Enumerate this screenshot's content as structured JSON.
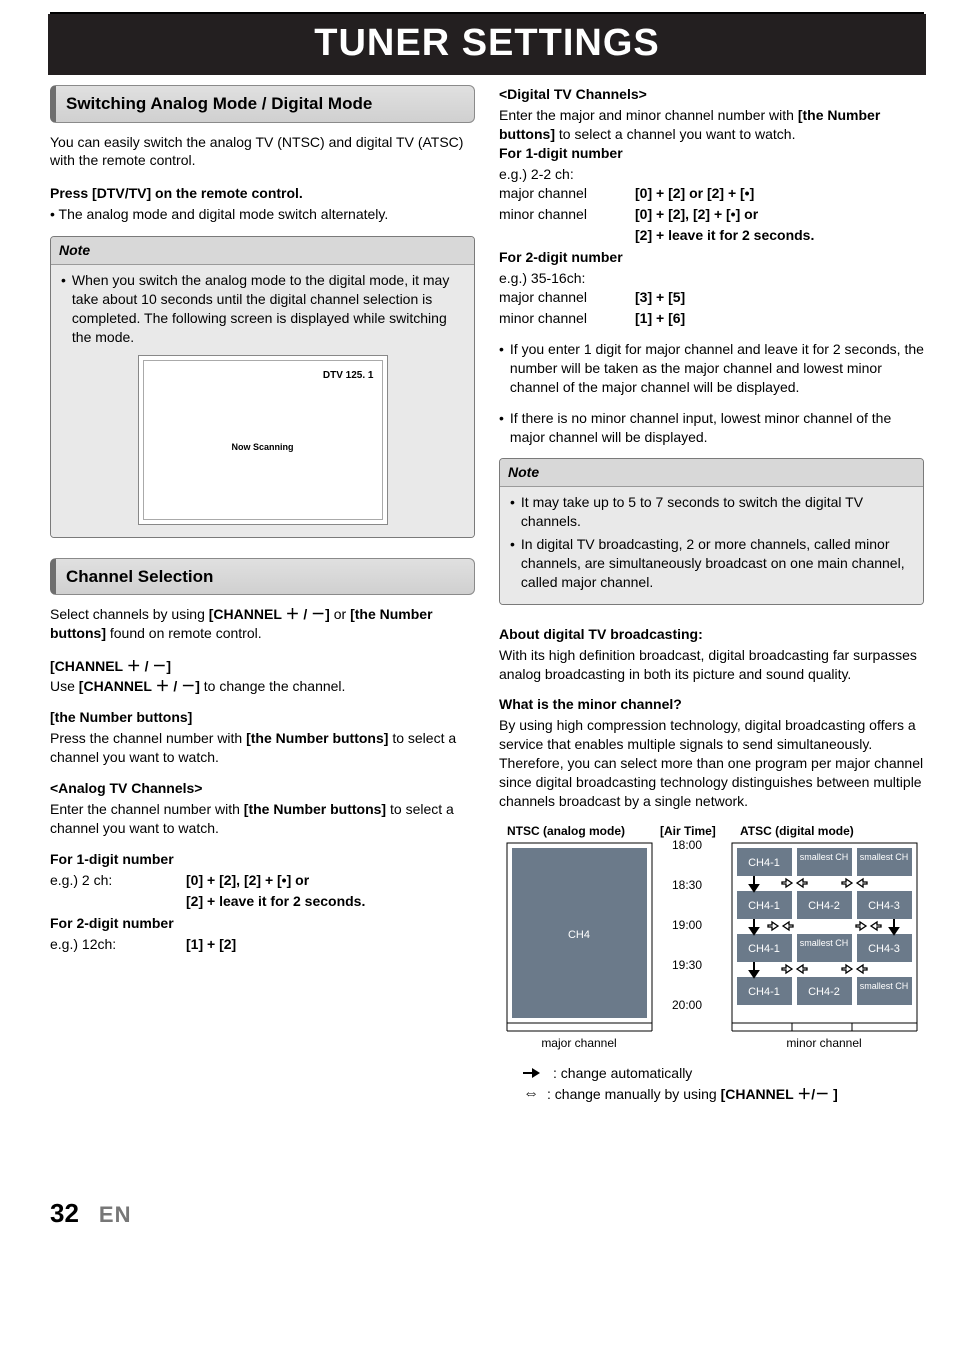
{
  "page_title": "TUNER SETTINGS",
  "left": {
    "section1_title": "Switching Analog Mode / Digital Mode",
    "intro": "You can easily switch the analog TV (NTSC) and digital TV (ATSC) with the remote control.",
    "press_label": "Press [DTV/TV] on the remote control.",
    "press_bullet": "• The analog mode and digital mode switch alternately.",
    "note_label": "Note",
    "note1": "When you switch the analog mode to the digital mode, it may take about 10 seconds until the digital channel selection is completed. The following screen is displayed while switching the mode.",
    "tv_tag": "DTV 125. 1",
    "tv_msg": "Now Scanning",
    "section2_title": "Channel Selection",
    "ch_intro_a": "Select channels by using ",
    "ch_intro_b": "[CHANNEL ＋ / －]",
    "ch_intro_c": " or ",
    "ch_intro_d": "[the Number buttons]",
    "ch_intro_e": " found on remote control.",
    "chpm_head": "[CHANNEL ＋ / －]",
    "chpm_body_a": "Use ",
    "chpm_body_b": "[CHANNEL ＋ / －]",
    "chpm_body_c": " to change the channel.",
    "numbtn_head": "[the Number buttons]",
    "numbtn_body_a": "Press the channel number with ",
    "numbtn_body_b": "[the Number buttons]",
    "numbtn_body_c": " to select a channel you want to watch.",
    "analog_head": "<Analog TV Channels>",
    "analog_intro_a": "Enter the channel number with ",
    "analog_intro_b": "[the Number buttons]",
    "analog_intro_c": " to select a channel you want to watch.",
    "for1_label": "For 1-digit number",
    "for1_eg_label": "e.g.) 2 ch:",
    "for1_eg_line1": "[0] + [2], [2] + [•] or",
    "for1_eg_line2": "[2] + leave it for 2 seconds.",
    "for2_label": "For 2-digit number",
    "for2_eg_label": "e.g.) 12ch:",
    "for2_eg_val": "[1] + [2]"
  },
  "right": {
    "digital_head": "<Digital TV Channels>",
    "digital_intro_a": "Enter the major and minor channel number with ",
    "digital_intro_b": "[the Number buttons]",
    "digital_intro_c": " to select a channel you want to watch.",
    "for1_label": "For 1-digit number",
    "for1_eg": "e.g.) 2-2 ch:",
    "for1_major_label": "major channel",
    "for1_major_val": "[0] + [2] or [2] + [•]",
    "for1_minor_label": "minor channel",
    "for1_minor_line1": "[0] + [2], [2] + [•] or",
    "for1_minor_line2": "[2] + leave it for 2 seconds.",
    "for2_label": "For 2-digit number",
    "for2_eg": "e.g.) 35-16ch:",
    "for2_major_label": "major channel",
    "for2_major_val": "[3] + [5]",
    "for2_minor_label": "minor channel",
    "for2_minor_val": "[1] + [6]",
    "bullet1": "If you enter 1 digit for major channel and leave it for 2 seconds, the number will be taken as the major channel and lowest minor channel of the major channel will be displayed.",
    "bullet2": "If there is no minor channel input, lowest minor channel of the major channel will be displayed.",
    "note_label": "Note",
    "note_b1": "It may take up to 5 to 7 seconds to switch the digital TV channels.",
    "note_b2": "In digital TV broadcasting, 2 or more channels, called minor channels, are simultaneously broadcast on one main channel, called major channel.",
    "about_head": "About digital TV broadcasting:",
    "about_body": "With its high definition broadcast, digital broadcasting far surpasses analog broadcasting in both its picture and sound quality.",
    "what_head": "What is the minor channel?",
    "what_p1": "By using high compression technology, digital broadcasting offers a service that enables multiple signals to send simultaneously.",
    "what_p2": "Therefore, you can select more than one program per major channel since digital broadcasting technology distinguishes between multiple channels broadcast by a single network.",
    "dia_ntsc": "NTSC (analog mode)",
    "dia_airtime": "[Air Time]",
    "dia_atsc": "ATSC (digital mode)",
    "dia_times": [
      "18:00",
      "18:30",
      "19:00",
      "19:30",
      "20:00"
    ],
    "dia_ch4": "CH4",
    "dia_ch41": "CH4-1",
    "dia_ch42": "CH4-2",
    "dia_ch43": "CH4-3",
    "dia_small": "smallest CH",
    "dia_major": "major channel",
    "dia_minor": "minor channel",
    "legend1": ": change automatically",
    "legend2a": ": change manually by using ",
    "legend2b": "[CHANNEL ＋/－ ]"
  },
  "footer": {
    "page": "32",
    "lang": "EN"
  }
}
